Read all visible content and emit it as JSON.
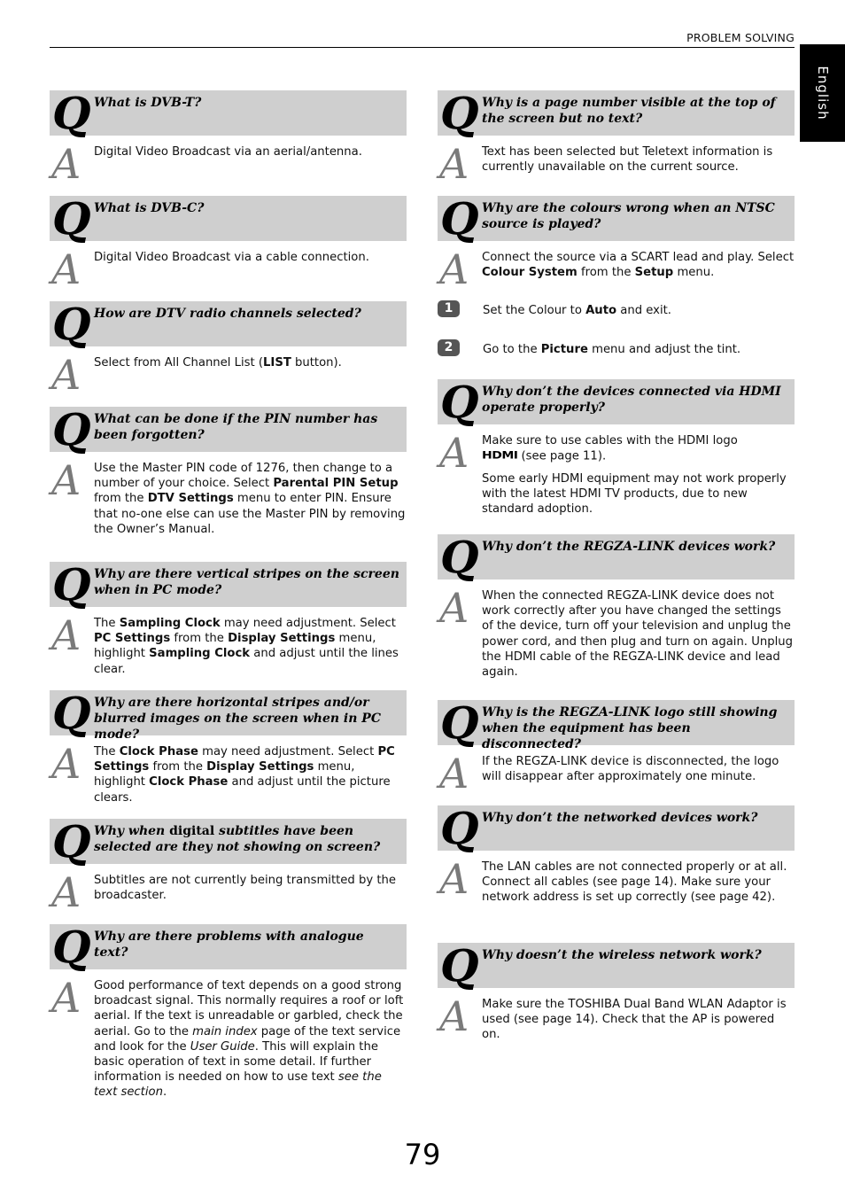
{
  "header": {
    "section_title": "PROBLEM SOLVING",
    "language_tab": "English"
  },
  "page_number": "79",
  "left": [
    {
      "q": "What is DVB-T?",
      "a": [
        "Digital Video Broadcast via an aerial/antenna."
      ]
    },
    {
      "q": "What is DVB-C?",
      "a": [
        "Digital Video Broadcast via a cable connection."
      ]
    },
    {
      "q": "How are DTV radio channels selected?",
      "a_parts": [
        "Select from All Channel List (",
        "LIST",
        " button)."
      ]
    },
    {
      "q": "What can be done if the PIN number has been forgotten?",
      "a_parts": [
        "Use the Master PIN code of 1276, then change to a number of your choice. Select ",
        "Parental PIN Setup",
        " from the ",
        "DTV Settings",
        " menu to enter PIN. Ensure that no-one else can use the Master PIN by removing the Owner’s Manual."
      ]
    },
    {
      "q": "Why are there vertical stripes on the screen when in PC mode?",
      "a_parts": [
        "The ",
        "Sampling Clock",
        " may need adjustment. Select ",
        "PC Settings",
        " from the ",
        "Display Settings",
        " menu, highlight ",
        "Sampling Clock",
        " and adjust until the lines clear."
      ]
    },
    {
      "q": "Why are there horizontal stripes and/or blurred images on the screen when in PC mode?",
      "a_parts": [
        "The ",
        "Clock Phase",
        " may need adjustment. Select ",
        "PC Settings",
        " from the ",
        "Display Settings",
        " menu, highlight ",
        "Clock Phase",
        " and adjust until the picture clears."
      ]
    },
    {
      "q_parts": [
        "Why when ",
        "digital",
        " subtitles have been selected are they not showing on screen?"
      ],
      "a": [
        "Subtitles are not currently being transmitted by the broadcaster."
      ]
    },
    {
      "q": "Why are there problems with analogue text?",
      "a_parts": [
        "Good performance of text depends on a good strong broadcast signal. This normally requires a roof or loft aerial. If the text is unreadable or garbled, check the aerial. Go to the ",
        "main index",
        " page of the text service and look for the ",
        "User Guide",
        ". This will explain the basic operation of text in some detail. If further information is needed on how to use text ",
        "see the text section",
        "."
      ]
    }
  ],
  "right": [
    {
      "q": "Why is a page number visible at the top of the screen but no text?",
      "a": [
        "Text has been selected but Teletext information is currently unavailable on the current source."
      ]
    },
    {
      "q": "Why are the colours wrong when an NTSC source is played?",
      "a_parts": [
        "Connect the source via a SCART lead and play. Select ",
        "Colour System",
        " from the ",
        "Setup",
        " menu."
      ],
      "steps": [
        {
          "num": "1",
          "parts": [
            "Set the Colour to ",
            "Auto",
            " and exit."
          ]
        },
        {
          "num": "2",
          "parts": [
            "Go to the ",
            "Picture",
            " menu and adjust the tint."
          ]
        }
      ]
    },
    {
      "q": "Why don’t the devices connected via HDMI operate properly?",
      "a_parts": [
        "Make sure to use cables with the HDMI logo",
        "HDMI",
        "(see page 11).",
        "Some early HDMI equipment may not work properly with the latest HDMI TV products, due to new standard adoption."
      ]
    },
    {
      "q": "Why don’t the REGZA-LINK devices work?",
      "a": [
        "When the connected REGZA-LINK device does not work correctly after you have changed the settings of the device, turn off your television and unplug the power cord, and then plug and turn on again. Unplug the HDMI cable of the REGZA-LINK device and lead again."
      ]
    },
    {
      "q": "Why is the REGZA-LINK logo still showing when the equipment has been disconnected?",
      "a": [
        "If the REGZA-LINK device is disconnected, the logo will disappear after approximately one minute."
      ]
    },
    {
      "q": "Why don’t the networked devices work?",
      "a": [
        "The LAN cables are not connected properly or at all. Connect all cables (see page 14). Make sure your network address is set up correctly (see page 42)."
      ]
    },
    {
      "q": "Why doesn’t the wireless network work?",
      "a": [
        "Make sure the TOSHIBA Dual Band WLAN Adaptor is used (see page 14). Check that the AP is powered on."
      ]
    }
  ],
  "glyphs": {
    "question": "Q",
    "answer": "A"
  }
}
